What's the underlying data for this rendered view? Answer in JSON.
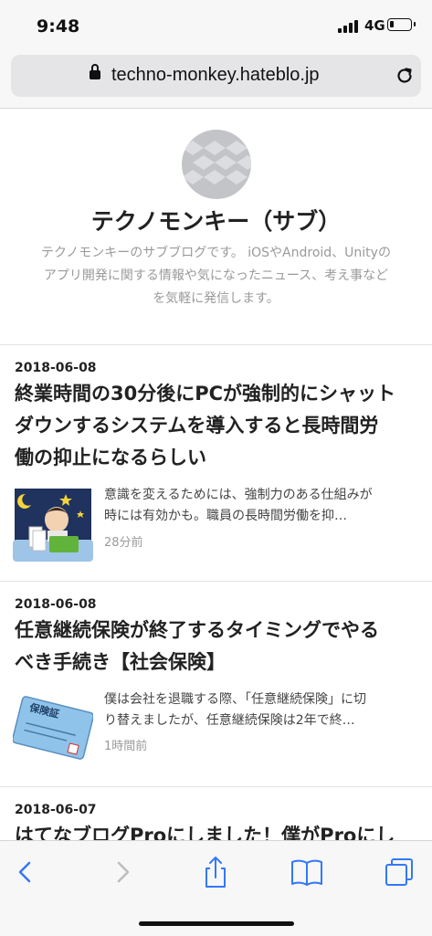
{
  "status": {
    "time": "9:48",
    "network": "4G"
  },
  "browser": {
    "url": "techno-monkey.hateblo.jp"
  },
  "blog": {
    "title": "テクノモンキー（サブ）",
    "description_line1": "テクノモンキーのサブブログです。 iOSやAndroid、Unityの",
    "description_line2": "アプリ開発に関する情報や気になったニュース、考え事など",
    "description_line3": "を気軽に発信します。"
  },
  "entries": [
    {
      "date": "2018-06-08",
      "title_line1": "終業時間の30分後にPCが強制的にシャット",
      "title_line2": "ダウンするシステムを導入すると長時間労",
      "title_line3": "働の抑止になるらしい",
      "excerpt_line1": "意識を変えるためには、強制力のある仕組みが",
      "excerpt_line2": "時には有効かも。職員の長時間労働を抑…",
      "ago": "28分前",
      "thumb_icon": "overwork-illustration"
    },
    {
      "date": "2018-06-08",
      "title_line1": "任意継続保険が終了するタイミングでやる",
      "title_line2": "べき手続き【社会保険】",
      "excerpt_line1": "僕は会社を退職する際、「任意継続保険」に切",
      "excerpt_line2": "り替えましたが、任意継続保険は2年で終…",
      "ago": "1時間前",
      "thumb_icon": "insurance-card-illustration",
      "thumb_label": "保険証"
    },
    {
      "date": "2018-06-07",
      "title_line1": "はてなブログProにしました！僕がProにし"
    }
  ],
  "toolbar": {
    "back_icon": "chevron-left-icon",
    "forward_icon": "chevron-right-icon",
    "share_icon": "share-icon",
    "bookmarks_icon": "book-icon",
    "tabs_icon": "tabs-icon"
  },
  "colors": {
    "accent": "#3478f6",
    "text": "#222222",
    "muted": "#9a9a9a"
  }
}
